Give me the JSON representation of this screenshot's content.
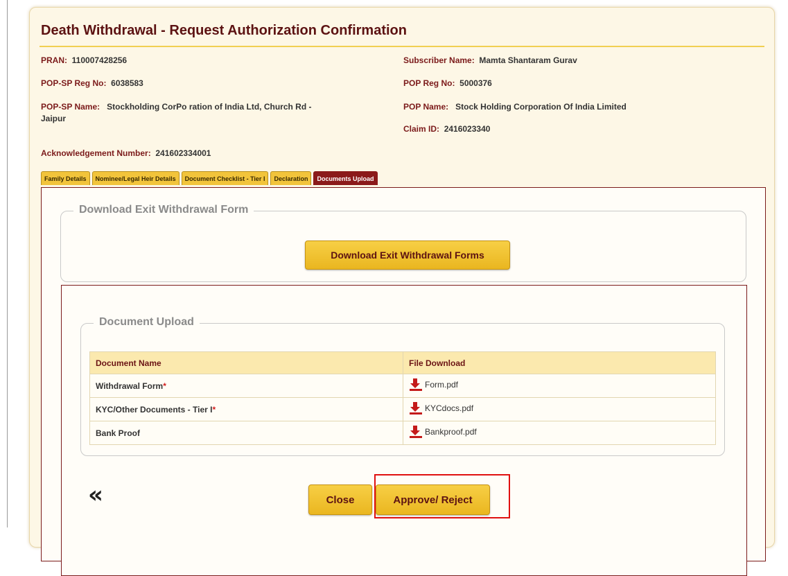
{
  "title": "Death Withdrawal - Request Authorization Confirmation",
  "fields": {
    "pran_label": "PRAN:",
    "pran_value": "110007428256",
    "subscriber_label": "Subscriber Name:",
    "subscriber_value": "Mamta Shantaram Gurav",
    "popsp_reg_label": "POP-SP Reg No:",
    "popsp_reg_value": "6038583",
    "pop_reg_label": "POP Reg No:",
    "pop_reg_value": "5000376",
    "popsp_name_label": "POP-SP Name:",
    "popsp_name_value_line1": "Stockholding CorPo ration of India Ltd, Church Rd -",
    "popsp_name_value_line2": "Jaipur",
    "pop_name_label": "POP Name:",
    "pop_name_value": "Stock Holding Corporation Of India Limited",
    "claim_label": "Claim ID:",
    "claim_value": "2416023340",
    "ack_label": "Acknowledgement Number:",
    "ack_value": "241602334001"
  },
  "tabs": [
    {
      "label": "Family Details",
      "active": false
    },
    {
      "label": "Nominee/Legal Heir Details",
      "active": false
    },
    {
      "label": "Document Checklist - Tier I",
      "active": false
    },
    {
      "label": "Declaration",
      "active": false
    },
    {
      "label": "Documents Upload",
      "active": true
    }
  ],
  "download_section": {
    "legend": "Download Exit Withdrawal Form",
    "button_label": "Download Exit Withdrawal Forms"
  },
  "upload_section": {
    "legend": "Document Upload",
    "headers": {
      "name": "Document Name",
      "file": "File Download"
    },
    "rows": [
      {
        "name": "Withdrawal Form",
        "required": "*",
        "file": "Form.pdf"
      },
      {
        "name": "KYC/Other Documents - Tier I",
        "required": "*",
        "file": "KYCdocs.pdf"
      },
      {
        "name": "Bank Proof",
        "required": "",
        "file": "Bankproof.pdf"
      }
    ]
  },
  "actions": {
    "back_glyph": "«",
    "close_label": "Close",
    "approve_label": "Approve/ Reject"
  },
  "colors": {
    "accent": "#f2c43b",
    "title": "#5c1212",
    "active_tab": "#8b1a1a",
    "highlight": "#e01010"
  },
  "icons": {
    "download": "download-arrow-icon"
  }
}
